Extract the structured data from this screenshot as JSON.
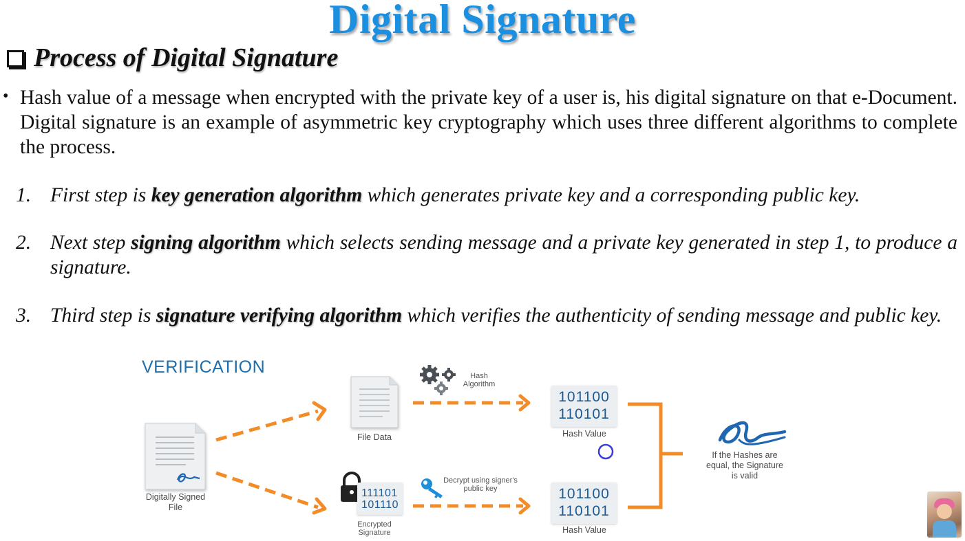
{
  "slide": {
    "title": "Digital Signature",
    "section_heading": "Process of Digital Signature",
    "bullet_symbol": "•",
    "intro_paragraph": "Hash value of a message when encrypted with the private key of a user is, his digital signature on that e-Document. Digital signature is an example of asymmetric key cryptography which uses three different algorithms to complete the process.",
    "steps": [
      {
        "number": "1.",
        "pre": "First step is ",
        "bold": "key generation algorithm",
        "post": " which generates private key and a corresponding public key."
      },
      {
        "number": "2.",
        "pre": "Next step ",
        "bold": "signing algorithm",
        "post": " which selects sending message and a private key generated in step 1, to produce a signature."
      },
      {
        "number": "3.",
        "pre": "Third step is ",
        "bold": "signature verifying algorithm",
        "post": " which verifies the authenticity of sending message and public key."
      }
    ]
  },
  "diagram": {
    "title": "VERIFICATION",
    "signed_file_label_1": "Digitally Signed",
    "signed_file_label_2": "File",
    "file_data_label": "File Data",
    "encrypted_label_1": "Encrypted",
    "encrypted_label_2": "Signature",
    "encrypted_bits_1": "111101",
    "encrypted_bits_2": "101110",
    "hash_algorithm_1": "Hash",
    "hash_algorithm_2": "Algorithm",
    "decrypt_1": "Decrypt using signer's",
    "decrypt_2": "public key",
    "hash_top_line1": "101100",
    "hash_top_line2": "110101",
    "hash_top_label": "Hash Value",
    "hash_bottom_line1": "101100",
    "hash_bottom_line2": "110101",
    "hash_bottom_label": "Hash Value",
    "result_1": "If the Hashes are",
    "result_2": "equal, the Signature",
    "result_3": "is valid",
    "colors": {
      "title_blue": "#1b8fe0",
      "arrow_orange": "#f28c28",
      "hash_text": "#1d5a94",
      "signature_blue": "#1f67b0",
      "cursor_ring": "#3b3bd8"
    }
  }
}
